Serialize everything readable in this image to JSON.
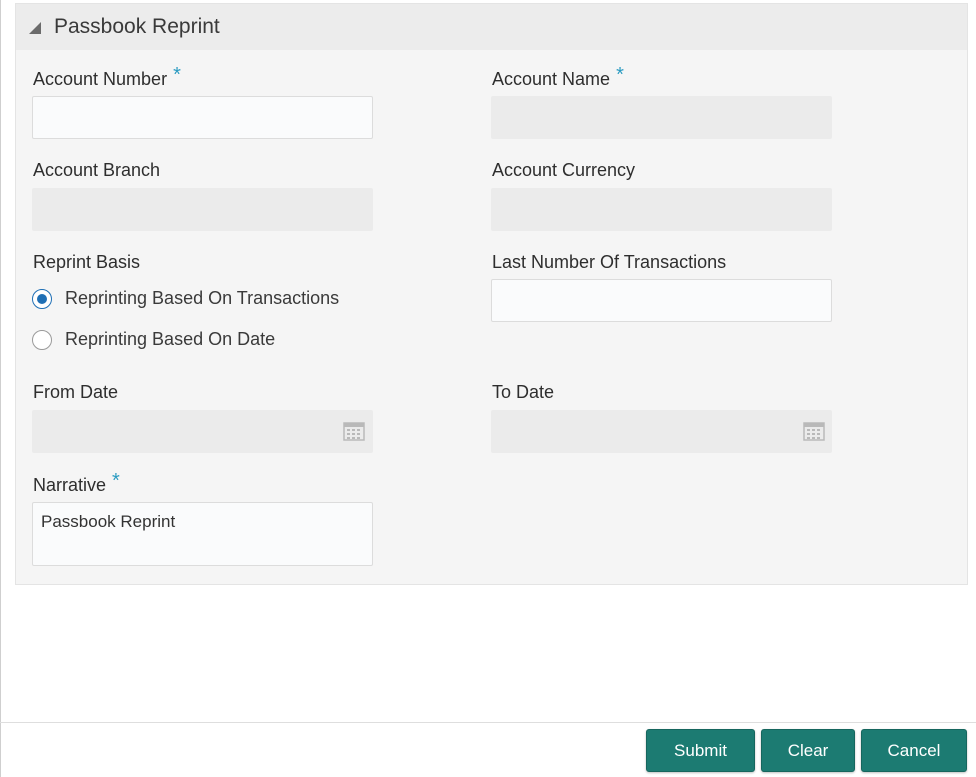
{
  "panel": {
    "title": "Passbook Reprint"
  },
  "fields": {
    "account_number": {
      "label": "Account Number",
      "required": "*",
      "value": ""
    },
    "account_name": {
      "label": "Account Name",
      "required": "*",
      "value": ""
    },
    "account_branch": {
      "label": "Account Branch",
      "value": ""
    },
    "account_currency": {
      "label": "Account Currency",
      "value": ""
    },
    "reprint_basis": {
      "label": "Reprint Basis",
      "options": [
        {
          "label": "Reprinting Based On Transactions",
          "selected": true
        },
        {
          "label": "Reprinting Based On Date",
          "selected": false
        }
      ]
    },
    "last_number_of_transactions": {
      "label": "Last Number Of Transactions",
      "value": ""
    },
    "from_date": {
      "label": "From Date",
      "value": "",
      "icon": "calendar-icon"
    },
    "to_date": {
      "label": "To Date",
      "value": "",
      "icon": "calendar-icon"
    },
    "narrative": {
      "label": "Narrative",
      "required": "*",
      "value": "Passbook Reprint"
    }
  },
  "footer": {
    "submit_label": "Submit",
    "clear_label": "Clear",
    "cancel_label": "Cancel"
  },
  "colors": {
    "accent_button": "#1c7b72",
    "required_marker": "#2a9bc1",
    "radio_selected": "#1f6fb5"
  }
}
